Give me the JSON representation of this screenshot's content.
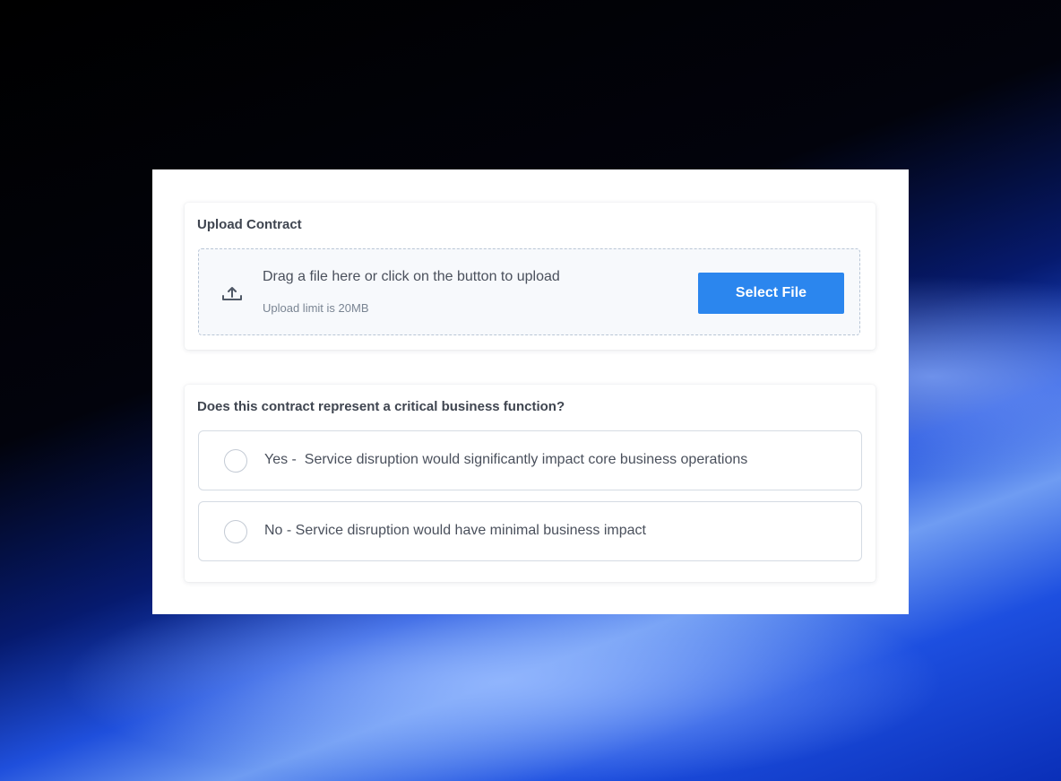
{
  "upload": {
    "title": "Upload Contract",
    "drop_text": "Drag a file here or click on the button to upload",
    "limit_text": "Upload limit is 20MB",
    "button_label": "Select File",
    "icon": "upload-icon"
  },
  "question": {
    "title": "Does this contract represent a critical business function?",
    "options": [
      {
        "label": "Yes -  Service disruption would significantly impact core business operations",
        "selected": false
      },
      {
        "label": "No - Service disruption would have minimal business impact",
        "selected": false
      }
    ]
  },
  "colors": {
    "accent": "#2b86ee",
    "text": "#4a505c",
    "muted": "#7a8593",
    "border": "#d5dbe3"
  }
}
